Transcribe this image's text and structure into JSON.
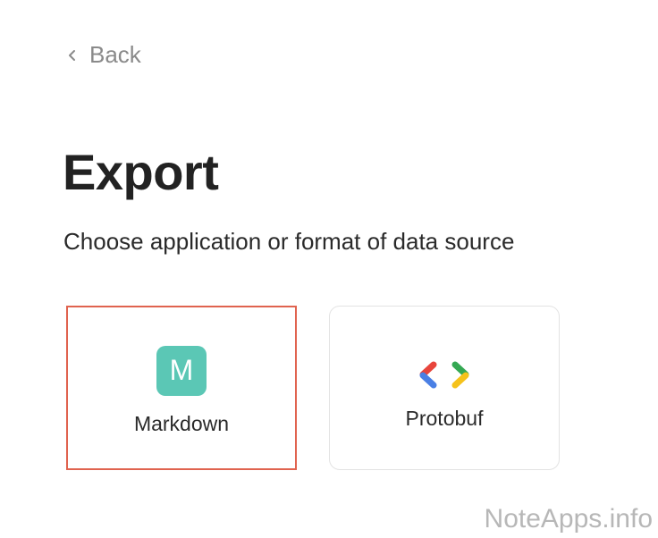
{
  "nav": {
    "back_label": "Back"
  },
  "header": {
    "title": "Export",
    "subtitle": "Choose application or format of data source"
  },
  "options": [
    {
      "label": "Markdown",
      "icon": "markdown-icon",
      "icon_letter": "M",
      "selected": true
    },
    {
      "label": "Protobuf",
      "icon": "protobuf-icon",
      "selected": false
    }
  ],
  "colors": {
    "selected_border": "#e0634f",
    "markdown_icon_bg": "#5bc7b5",
    "proto_red": "#e8453c",
    "proto_blue": "#4a7fe4",
    "proto_green": "#34a853",
    "proto_yellow": "#f5c21b"
  },
  "watermark": "NoteApps.info"
}
